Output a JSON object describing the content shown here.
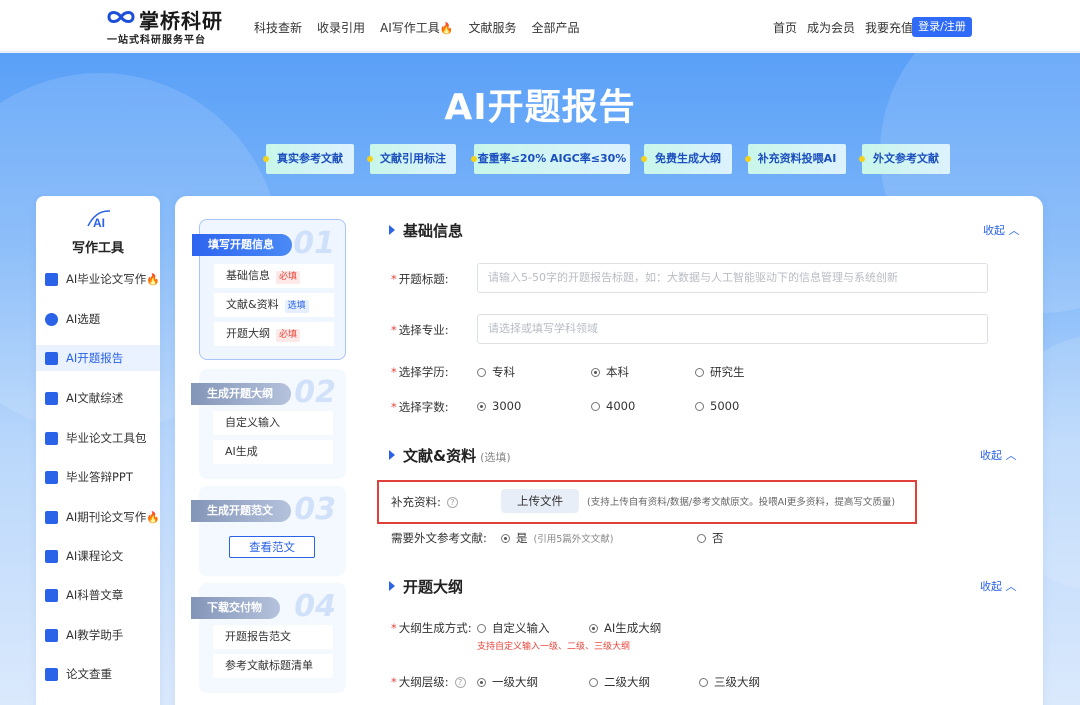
{
  "topbar": {
    "brand_name": "掌桥科研",
    "slogan": "一站式科研服务平台",
    "nav": [
      "科技查新",
      "收录引用",
      "AI写作工具",
      "文献服务",
      "全部产品"
    ],
    "nav_right": [
      "首页",
      "成为会员",
      "我要充值"
    ],
    "login": "登录/注册"
  },
  "hero": {
    "title": "AI开题报告",
    "tags": [
      "真实参考文献",
      "文献引用标注",
      "查重率≤20%  AIGC率≤30%",
      "免费生成大纲",
      "补充资料投喂AI",
      "外文参考文献"
    ]
  },
  "sidebar": {
    "logo_text": "AI",
    "title": "写作工具",
    "items": [
      {
        "label": "AI毕业论文写作",
        "fire": true
      },
      {
        "label": "AI选题"
      },
      {
        "label": "AI开题报告",
        "active": true
      },
      {
        "label": "AI文献综述"
      },
      {
        "label": "毕业论文工具包"
      },
      {
        "label": "毕业答辩PPT"
      },
      {
        "label": "AI期刊论文写作",
        "fire": true
      },
      {
        "label": "AI课程论文"
      },
      {
        "label": "AI科普文章"
      },
      {
        "label": "AI教学助手"
      },
      {
        "label": "论文查重"
      }
    ]
  },
  "steps": [
    {
      "num": "01",
      "title": "填写开题信息",
      "subs": [
        {
          "label": "基础信息",
          "badge": "必填",
          "badge_type": "red"
        },
        {
          "label": "文献&资料",
          "badge": "选填",
          "badge_type": "blue"
        },
        {
          "label": "开题大纲",
          "badge": "必填",
          "badge_type": "red"
        }
      ]
    },
    {
      "num": "02",
      "title": "生成开题大纲",
      "subs": [
        {
          "label": "自定义输入"
        },
        {
          "label": "AI生成"
        }
      ]
    },
    {
      "num": "03",
      "title": "生成开题范文",
      "button": "查看范文"
    },
    {
      "num": "04",
      "title": "下载交付物",
      "subs": [
        {
          "label": "开题报告范文"
        },
        {
          "label": "参考文献标题清单"
        }
      ]
    }
  ],
  "form": {
    "basic": {
      "title": "基础信息",
      "collapse": "收起",
      "topic_label": "开题标题:",
      "topic_placeholder": "请输入5-50字的开题报告标题，如：大数据与人工智能驱动下的信息管理与系统创新",
      "major_label": "选择专业:",
      "major_placeholder": "请选择或填写学科领域",
      "degree_label": "选择学历:",
      "degree_options": [
        "专科",
        "本科",
        "研究生"
      ],
      "degree_selected": "本科",
      "words_label": "选择字数:",
      "words_options": [
        "3000",
        "4000",
        "5000"
      ],
      "words_selected": "3000"
    },
    "literature": {
      "title": "文献&资料",
      "optional": "(选填)",
      "collapse": "收起",
      "supplement_label": "补充资料:",
      "upload_button": "上传文件",
      "upload_hint": "(支持上传自有资料/数据/参考文献原文。投喂AI更多资料，提高写文质量)",
      "foreign_label": "需要外文参考文献:",
      "foreign_yes": "是",
      "foreign_yes_hint": "(引用5篇外文文献)",
      "foreign_no": "否",
      "foreign_selected": "是"
    },
    "outline": {
      "title": "开题大纲",
      "collapse": "收起",
      "method_label": "大纲生成方式:",
      "method_options": [
        "自定义输入",
        "AI生成大纲"
      ],
      "method_selected": "AI生成大纲",
      "method_hint": "支持自定义输入一级、二级、三级大纲",
      "level_label": "大纲层级:",
      "level_options": [
        "一级大纲",
        "二级大纲",
        "三级大纲"
      ],
      "level_selected": "一级大纲"
    }
  },
  "colors": {
    "primary": "#2a62e8",
    "required": "#e8453c",
    "highlight_box": "#e0403a"
  }
}
